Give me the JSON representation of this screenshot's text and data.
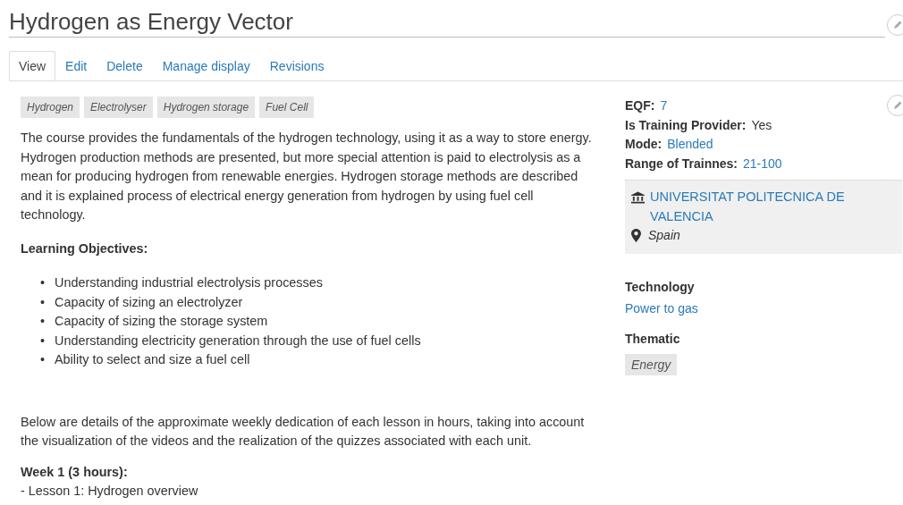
{
  "title": "Hydrogen as Energy Vector",
  "tabs": [
    {
      "label": "View",
      "selected": true
    },
    {
      "label": "Edit",
      "selected": false
    },
    {
      "label": "Delete",
      "selected": false
    },
    {
      "label": "Manage display",
      "selected": false
    },
    {
      "label": "Revisions",
      "selected": false
    }
  ],
  "tags": [
    "Hydrogen",
    "Electrolyser",
    "Hydrogen storage",
    "Fuel Cell"
  ],
  "description": "The course provides the fundamentals of the hydrogen technology, using it as a way to store energy. Hydrogen production methods are presented, but more special attention is paid to electrolysis as a mean for producing hydrogen from renewable energies. Hydrogen storage methods are described and it is explained process of electrical energy generation from hydrogen by using fuel cell technology.",
  "objectives_heading": "Learning Objectives:",
  "objectives": [
    {
      "bullet": "•",
      "text": "Understanding industrial electrolysis processes"
    },
    {
      "bullet": "•",
      "text": "Capacity of sizing an electrolyzer"
    },
    {
      "bullet": "•",
      "text": "Capacity of sizing the storage system"
    },
    {
      "bullet": "•",
      "text": "Understanding electricity generation through the use of fuel cells"
    },
    {
      "bullet": "•",
      "text": "Ability to select and size a fuel cell"
    }
  ],
  "dedication_text": "Below are details of the approximate weekly dedication of each lesson in hours, taking into account the visualization of the videos and the realization of the quizzes associated with each unit.",
  "week_heading": "Week 1 (3 hours):",
  "lesson": "- Lesson 1: Hydrogen overview",
  "fields": [
    {
      "label": "EQF:",
      "value": "7",
      "kind": "link"
    },
    {
      "label": "Is Training Provider:",
      "value": "Yes",
      "kind": "plain"
    },
    {
      "label": "Mode:",
      "value": "Blended",
      "kind": "link"
    },
    {
      "label": "Range of Trainnes:",
      "value": "21-100",
      "kind": "link"
    }
  ],
  "provider": {
    "name": "UNIVERSITAT POLITECNICA DE VALENCIA",
    "country": "Spain"
  },
  "technology": {
    "heading": "Technology",
    "value": "Power to gas"
  },
  "thematic": {
    "heading": "Thematic",
    "tag": "Energy"
  }
}
